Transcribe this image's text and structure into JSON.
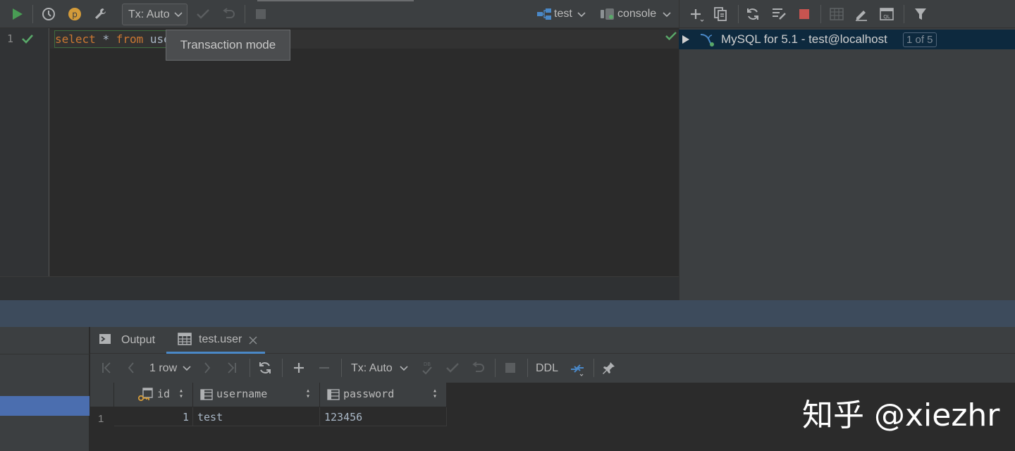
{
  "editor_toolbar": {
    "tx_mode": "Tx: Auto",
    "schema": "test",
    "session": "console"
  },
  "tooltip": "Transaction mode",
  "editor": {
    "line_number": "1",
    "code": {
      "kw_select": "select",
      "star": "*",
      "kw_from": "from",
      "table_partial": "use"
    }
  },
  "database_panel": {
    "connection_label": "MySQL for 5.1 - test@localhost",
    "connection_count": "1 of 5"
  },
  "results": {
    "tabs": [
      {
        "label": "Output"
      },
      {
        "label": "test.user"
      }
    ],
    "toolbar": {
      "rows": "1 row",
      "tx_mode": "Tx: Auto",
      "ddl": "DDL"
    },
    "columns": [
      "id",
      "username",
      "password"
    ],
    "rows": [
      {
        "row_number": "1",
        "id": "1",
        "username": "test",
        "password": "123456"
      }
    ]
  },
  "watermark": "知乎 @xiezhr",
  "colors": {
    "run_green": "#499c54",
    "stop_red": "#c75450",
    "selection_blue": "#4b6eaf",
    "keyword_orange": "#cc7832"
  }
}
